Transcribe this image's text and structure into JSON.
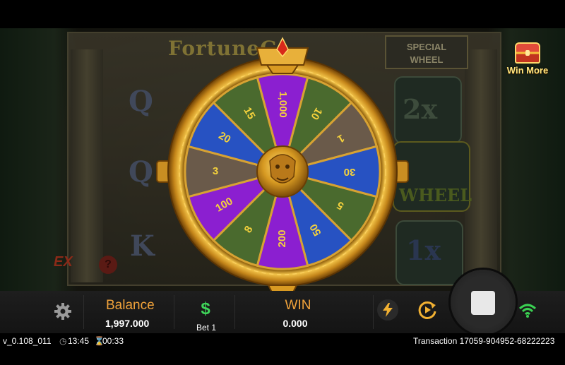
{
  "background": {
    "game_logo": "FortuneG",
    "special_wheel_title": [
      "SPECIAL",
      "WHEEL"
    ],
    "reel_symbols": [
      "Q",
      "Q",
      "K",
      "2x",
      "WHEEL",
      "1x"
    ],
    "ex_badge": "EX",
    "help_glyph": "?"
  },
  "win_more": {
    "label": "Win More",
    "icon": "treasure-chest-icon"
  },
  "wheel": {
    "segments": [
      {
        "label": "1,000",
        "color": "#8b1fd0"
      },
      {
        "label": "10",
        "color": "#4a6a2e"
      },
      {
        "label": "1",
        "color": "#6a5a4a"
      },
      {
        "label": "30",
        "color": "#2752c2"
      },
      {
        "label": "5",
        "color": "#4a6a2e"
      },
      {
        "label": "50",
        "color": "#2752c2"
      },
      {
        "label": "200",
        "color": "#8b1fd0"
      },
      {
        "label": "8",
        "color": "#4a6a2e"
      },
      {
        "label": "100",
        "color": "#8b1fd0"
      },
      {
        "label": "3",
        "color": "#6a5a4a"
      },
      {
        "label": "20",
        "color": "#2752c2"
      },
      {
        "label": "15",
        "color": "#4a6a2e"
      }
    ],
    "rim_color": "#e0a82a",
    "label_color": "#f5d23c",
    "center_icon": "golden-lion-mask-icon"
  },
  "bottom_bar": {
    "settings_icon": "gear-icon",
    "balance_label": "Balance",
    "balance_value": "1,997.000",
    "bet_icon": "dollar-icon",
    "bet_label": "Bet 1",
    "win_label": "WIN",
    "win_value": "0.000",
    "turbo_icon": "lightning-icon",
    "autoplay_icon": "autoplay-icon",
    "stop_icon": "stop-icon",
    "wifi_icon": "wifi-icon"
  },
  "status_bar": {
    "version": "v_0.108_011",
    "clock": "13:45",
    "session_timer": "00:33",
    "transaction": "Transaction 17059-904952-68222223"
  },
  "colors": {
    "accent_orange": "#f0a23a",
    "bet_green": "#3fd65a",
    "wifi_green": "#3ad052"
  }
}
